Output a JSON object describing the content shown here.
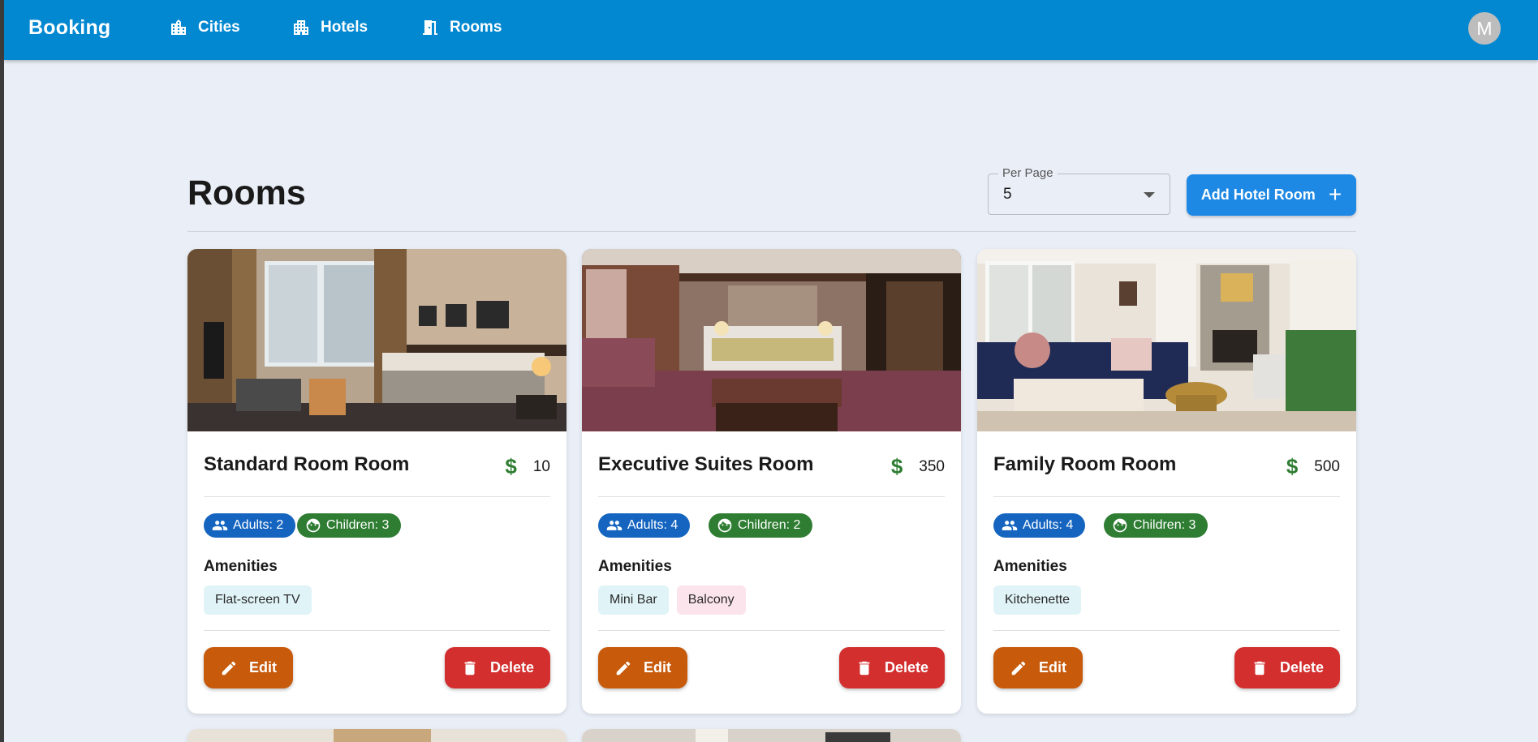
{
  "app": {
    "brand": "Booking",
    "avatar_initial": "M"
  },
  "nav": [
    {
      "label": "Cities",
      "icon": "city-icon"
    },
    {
      "label": "Hotels",
      "icon": "hotel-building-icon"
    },
    {
      "label": "Rooms",
      "icon": "door-icon"
    }
  ],
  "page": {
    "title": "Rooms"
  },
  "per_page": {
    "label": "Per Page",
    "value": "5"
  },
  "add_button": {
    "label": "Add Hotel Room",
    "icon": "plus-icon"
  },
  "rooms": [
    {
      "name": "Standard Room Room",
      "price": "10",
      "adults": "Adults: 2",
      "children": "Children: 3",
      "amenities_title": "Amenities",
      "amenities": [
        "Flat-screen TV"
      ],
      "edit_label": "Edit",
      "delete_label": "Delete"
    },
    {
      "name": "Executive Suites Room",
      "price": "350",
      "adults": "Adults: 4",
      "children": "Children: 2",
      "amenities_title": "Amenities",
      "amenities": [
        "Mini Bar",
        "Balcony"
      ],
      "edit_label": "Edit",
      "delete_label": "Delete"
    },
    {
      "name": "Family Room Room",
      "price": "500",
      "adults": "Adults: 4",
      "children": "Children: 3",
      "amenities_title": "Amenities",
      "amenities": [
        "Kitchenette"
      ],
      "edit_label": "Edit",
      "delete_label": "Delete"
    }
  ],
  "colors": {
    "appbar": "#0288d1",
    "background": "#eaeff7",
    "add_button": "#1e88e5",
    "adults_chip": "#1565c0",
    "children_chip": "#2e7d32",
    "price_icon": "#2e7d32",
    "edit_button": "#c75a0b",
    "delete_button": "#d32f2f",
    "amenity_blue": "#e0f4f8",
    "amenity_pink": "#fce4ec"
  }
}
